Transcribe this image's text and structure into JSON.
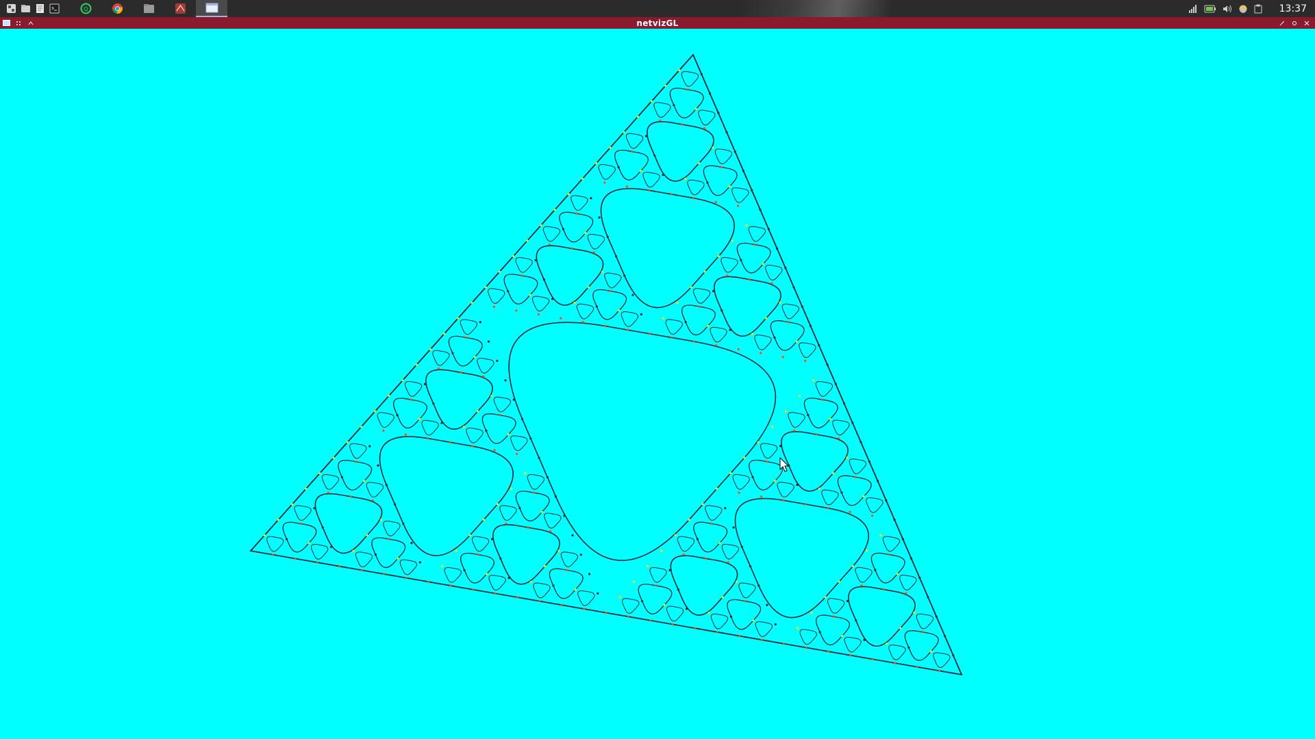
{
  "taskbar": {
    "launchers": [
      {
        "icon": "app-menu-icon"
      },
      {
        "icon": "file-manager-icon"
      },
      {
        "icon": "text-editor-icon"
      },
      {
        "icon": "terminal-icon"
      }
    ],
    "tasks": [
      {
        "icon": "qt-creator-icon",
        "active": false
      },
      {
        "icon": "chrome-icon",
        "active": false
      },
      {
        "icon": "folder-icon",
        "active": false
      },
      {
        "icon": "network-app-icon",
        "active": false
      },
      {
        "icon": "window-app-icon",
        "active": true
      }
    ],
    "tray": {
      "icons": [
        "signal-icon",
        "battery-icon",
        "volume-icon",
        "weather-icon",
        "clipboard-icon"
      ],
      "clock": "13:37"
    }
  },
  "window": {
    "title": "netvizGL",
    "background": "#00ffff",
    "titlebar_color": "#8a1a2e"
  },
  "visualization": {
    "depiction": "sierpinski-like fractal graph",
    "edge_color": "#1a2a3a",
    "node_colors": [
      "#ffe000",
      "#ff4a00",
      "#2a2a2a"
    ]
  }
}
